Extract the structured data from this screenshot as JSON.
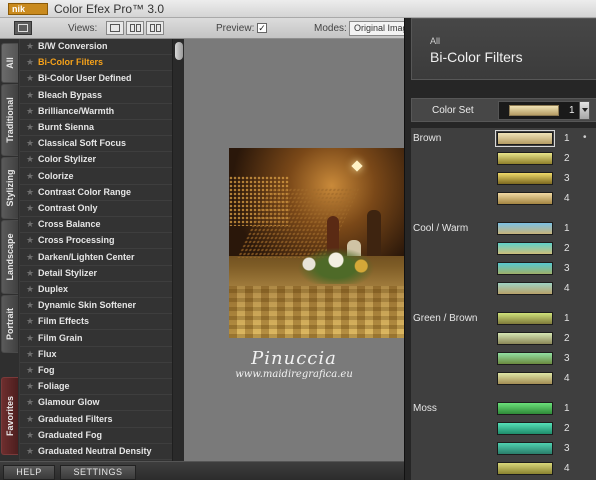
{
  "app": {
    "logo_text": "nik",
    "title": "Color Efex Pro™ 3.0"
  },
  "toolbar": {
    "views_label": "Views:",
    "preview_label": "Preview:",
    "preview_checked": true,
    "preview_check_glyph": "✓",
    "modes_label": "Modes:",
    "mode_value": "Original Image"
  },
  "tabs": [
    {
      "label": "All",
      "active": true
    },
    {
      "label": "Traditional",
      "active": false
    },
    {
      "label": "Stylizing",
      "active": false
    },
    {
      "label": "Landscape",
      "active": false
    },
    {
      "label": "Portrait",
      "active": false
    },
    {
      "label": "Favorites",
      "active": false
    }
  ],
  "filters": {
    "star_glyph": "★",
    "selected": "Bi-Color Filters",
    "items": [
      "B/W Conversion",
      "Bi-Color Filters",
      "Bi-Color User Defined",
      "Bleach Bypass",
      "Brilliance/Warmth",
      "Burnt Sienna",
      "Classical Soft Focus",
      "Color Stylizer",
      "Colorize",
      "Contrast Color Range",
      "Contrast Only",
      "Cross Balance",
      "Cross Processing",
      "Darken/Lighten Center",
      "Detail Stylizer",
      "Duplex",
      "Dynamic Skin Softener",
      "Film Effects",
      "Film Grain",
      "Flux",
      "Fog",
      "Foliage",
      "Glamour Glow",
      "Graduated Filters",
      "Graduated Fog",
      "Graduated Neutral Density"
    ]
  },
  "preview_image": {
    "watermark_name": "Pinuccia",
    "watermark_url": "www.maidiregrafica.eu"
  },
  "panel": {
    "category": "All",
    "title": "Bi-Color Filters",
    "color_set_label": "Color Set",
    "color_set_value": "1",
    "selected_indicator": "•",
    "groups": [
      {
        "name": "Brown",
        "swatches": [
          {
            "num": "1",
            "top": "#f0e3b8",
            "bottom": "#b59c63",
            "selected": true
          },
          {
            "num": "2",
            "top": "#e9e58a",
            "bottom": "#8f7f2b",
            "selected": false
          },
          {
            "num": "3",
            "top": "#efd96a",
            "bottom": "#7d6920",
            "selected": false
          },
          {
            "num": "4",
            "top": "#f1d9a3",
            "bottom": "#a38542",
            "selected": false
          }
        ]
      },
      {
        "name": "Cool / Warm",
        "swatches": [
          {
            "num": "1",
            "top": "#7cc1e4",
            "bottom": "#c7b37a",
            "selected": false
          },
          {
            "num": "2",
            "top": "#5fd1c9",
            "bottom": "#cdbd7a",
            "selected": false
          },
          {
            "num": "3",
            "top": "#57c8d0",
            "bottom": "#9fb06a",
            "selected": false
          },
          {
            "num": "4",
            "top": "#9fd2c3",
            "bottom": "#b8a26a",
            "selected": false
          }
        ]
      },
      {
        "name": "Green / Brown",
        "swatches": [
          {
            "num": "1",
            "top": "#cfe27b",
            "bottom": "#7f7a3a",
            "selected": false
          },
          {
            "num": "2",
            "top": "#d6e7b4",
            "bottom": "#8b8758",
            "selected": false
          },
          {
            "num": "3",
            "top": "#92e0a3",
            "bottom": "#6b8a3f",
            "selected": false
          },
          {
            "num": "4",
            "top": "#dfe6a6",
            "bottom": "#a38d54",
            "selected": false
          }
        ]
      },
      {
        "name": "Moss",
        "swatches": [
          {
            "num": "1",
            "top": "#6be07a",
            "bottom": "#2f8a38",
            "selected": false
          },
          {
            "num": "2",
            "top": "#56e0b8",
            "bottom": "#1f8c6a",
            "selected": false
          },
          {
            "num": "3",
            "top": "#4fd0b0",
            "bottom": "#2a7e6a",
            "selected": false
          },
          {
            "num": "4",
            "top": "#d9d77a",
            "bottom": "#8a8330",
            "selected": false
          }
        ]
      }
    ]
  },
  "bottom_bar": {
    "help_label": "HELP",
    "settings_label": "SETTINGS"
  },
  "colors": {
    "accent_selected": "#f6a21a",
    "favorites_tab": "#6e2e2e"
  }
}
